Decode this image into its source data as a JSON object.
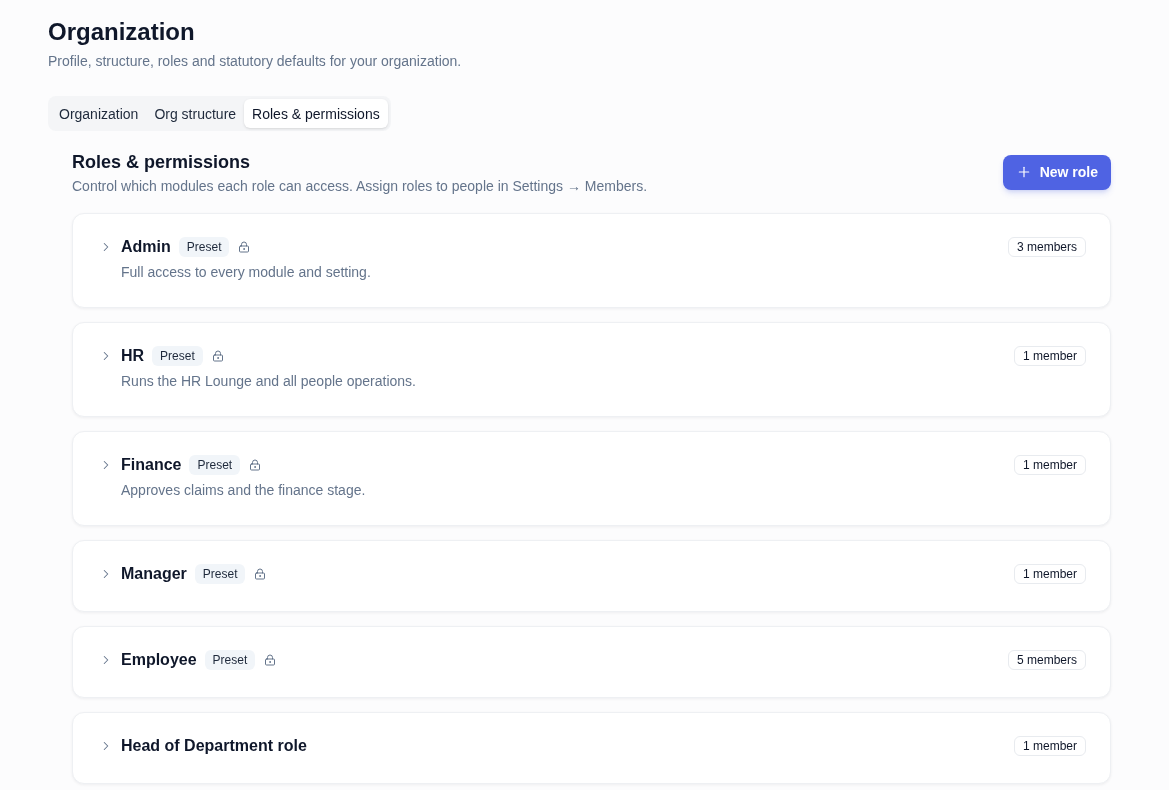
{
  "page": {
    "title": "Organization",
    "subtitle": "Profile, structure, roles and statutory defaults for your organization."
  },
  "tabs": [
    {
      "label": "Organization",
      "selected": false
    },
    {
      "label": "Org structure",
      "selected": false
    },
    {
      "label": "Roles & permissions",
      "selected": true
    }
  ],
  "section": {
    "title": "Roles & permissions",
    "description": "Control which modules each role can access. Assign roles to people in Settings → Members.",
    "new_button": "New role"
  },
  "roles": [
    {
      "name": "Admin",
      "badge": "Preset",
      "locked": true,
      "expanded": false,
      "description": "Full access to every module and setting.",
      "members": "3 members"
    },
    {
      "name": "HR",
      "badge": "Preset",
      "locked": true,
      "expanded": false,
      "description": "Runs the HR Lounge and all people operations.",
      "members": "1 member"
    },
    {
      "name": "Finance",
      "badge": "Preset",
      "locked": true,
      "expanded": false,
      "description": "Approves claims and the finance stage.",
      "members": "1 member"
    },
    {
      "name": "Manager",
      "badge": "Preset",
      "locked": true,
      "expanded": false,
      "members": "1 member"
    },
    {
      "name": "Employee",
      "badge": "Preset",
      "locked": true,
      "expanded": false,
      "members": "5 members"
    },
    {
      "name": "Head of Department role",
      "locked": false,
      "expanded": false,
      "members": "1 member"
    }
  ]
}
